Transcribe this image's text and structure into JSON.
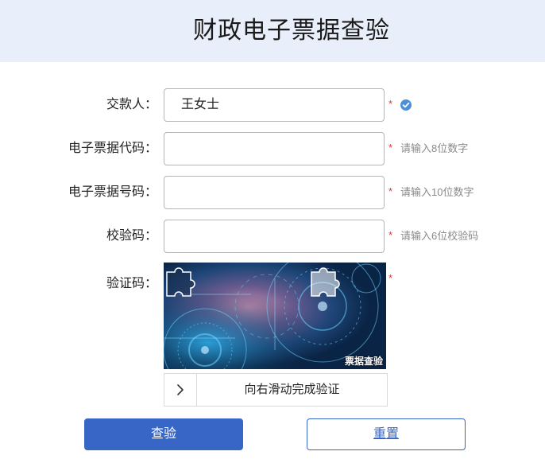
{
  "header": {
    "title": "财政电子票据查验"
  },
  "form": {
    "payer": {
      "label": "交款人：",
      "value": "王女士",
      "required_mark": "*",
      "status_icon": "check-circle-icon"
    },
    "code": {
      "label": "电子票据代码：",
      "value": "",
      "required_mark": "*",
      "hint": "请输入8位数字"
    },
    "number": {
      "label": "电子票据号码：",
      "value": "",
      "required_mark": "*",
      "hint": "请输入10位数字"
    },
    "check_code": {
      "label": "校验码：",
      "value": "",
      "required_mark": "*",
      "hint": "请输入6位校验码"
    },
    "captcha": {
      "label": "验证码：",
      "required_mark": "*",
      "watermark": "票据查验",
      "slider_text": "向右滑动完成验证",
      "slider_icon": "chevron-right-icon"
    }
  },
  "actions": {
    "submit_label": "查验",
    "reset_label": "重置"
  },
  "colors": {
    "accent": "#3766c7",
    "required": "#e0393b",
    "header_bg": "#e9eefb",
    "check": "#4a90d9"
  }
}
